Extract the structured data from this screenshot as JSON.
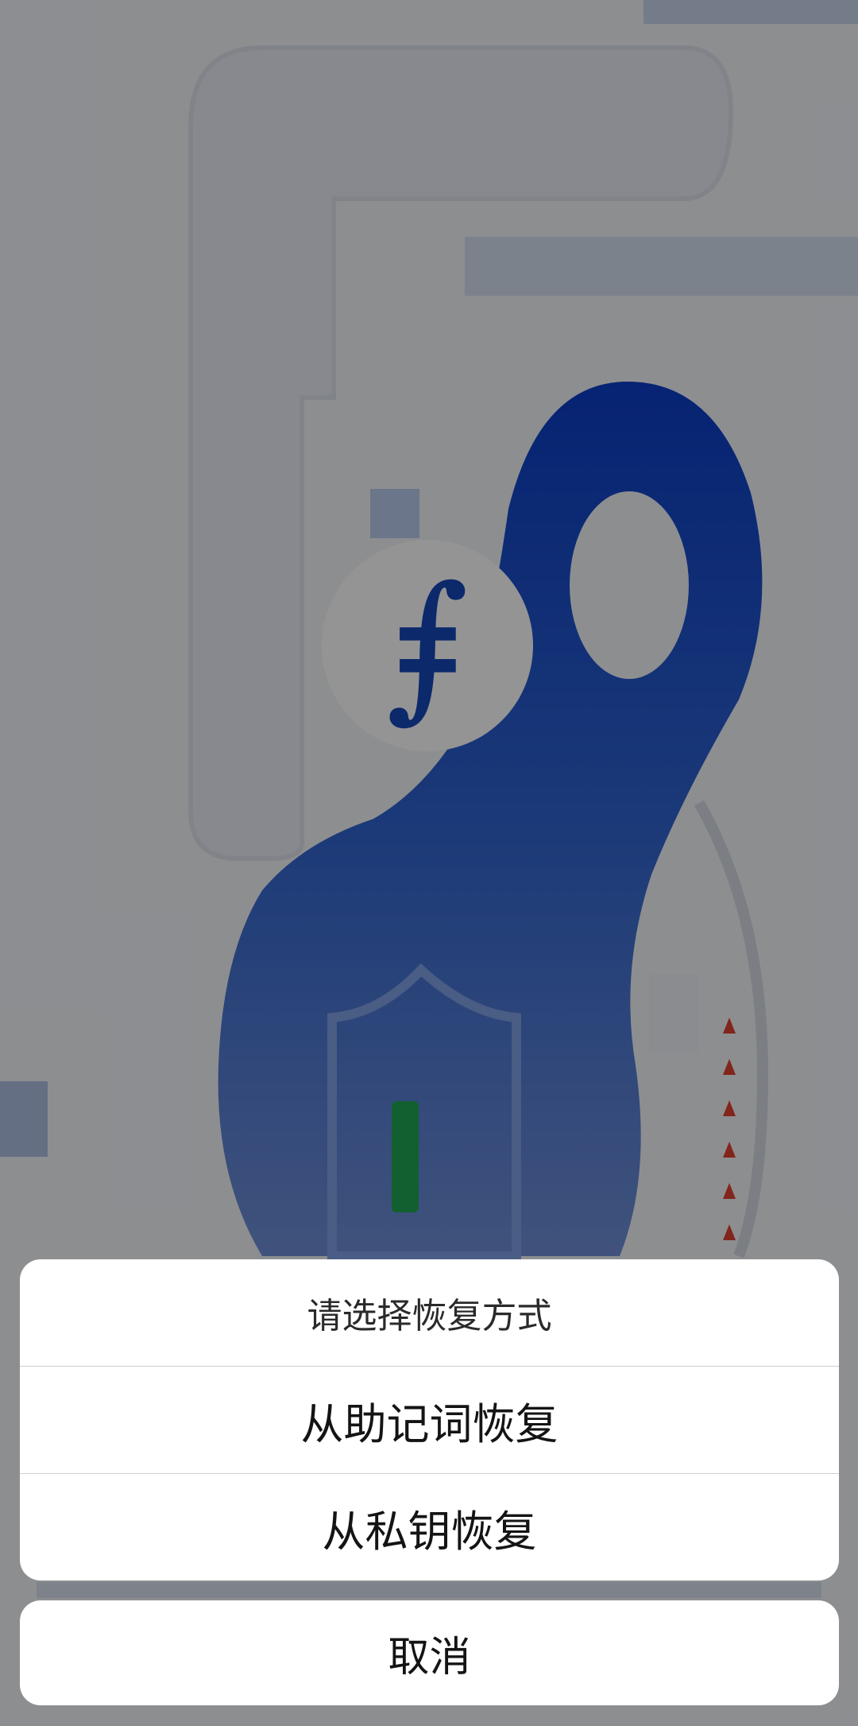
{
  "background": {
    "logo_glyph": "⨎",
    "icons": [
      "filecoin-logo-icon",
      "shield-icon",
      "warning-triangle-icon"
    ],
    "colors": {
      "brand_blue": "#0d3fb8",
      "shield_green": "#1fa653",
      "alert_red": "#e0402f",
      "overlay": "rgba(0,0,0,0.42)"
    }
  },
  "action_sheet": {
    "title": "请选择恢复方式",
    "options": [
      {
        "label": "从助记词恢复"
      },
      {
        "label": "从私钥恢复"
      }
    ]
  },
  "cancel": {
    "label": "取消"
  }
}
